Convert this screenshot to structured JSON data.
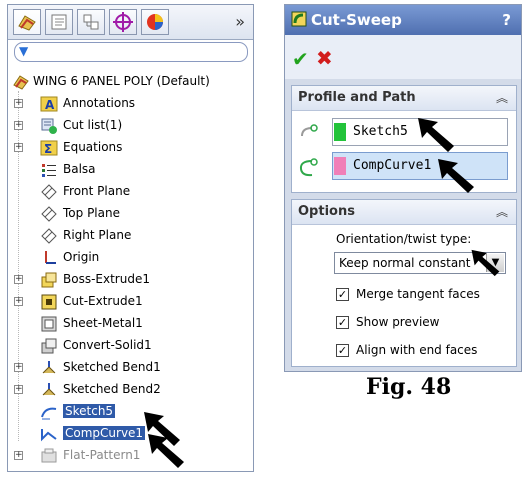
{
  "tree": {
    "root_label": "WING 6 PANEL POLY  (Default)",
    "items": [
      {
        "label": "Annotations",
        "expandable": true
      },
      {
        "label": "Cut list(1)",
        "expandable": true
      },
      {
        "label": "Equations",
        "expandable": true
      },
      {
        "label": "Balsa",
        "expandable": false
      },
      {
        "label": "Front Plane",
        "expandable": false
      },
      {
        "label": "Top Plane",
        "expandable": false
      },
      {
        "label": "Right Plane",
        "expandable": false
      },
      {
        "label": "Origin",
        "expandable": false
      },
      {
        "label": "Boss-Extrude1",
        "expandable": true
      },
      {
        "label": "Cut-Extrude1",
        "expandable": true
      },
      {
        "label": "Sheet-Metal1",
        "expandable": false
      },
      {
        "label": "Convert-Solid1",
        "expandable": false
      },
      {
        "label": "Sketched Bend1",
        "expandable": true
      },
      {
        "label": "Sketched Bend2",
        "expandable": true
      },
      {
        "label": "Sketch5",
        "expandable": false,
        "selected": true
      },
      {
        "label": "CompCurve1",
        "expandable": false,
        "selected": true
      },
      {
        "label": "Flat-Pattern1",
        "expandable": true,
        "dimmed": true
      }
    ],
    "more_tabs": "»"
  },
  "property_manager": {
    "title": "Cut-Sweep",
    "help": "?",
    "ok_symbol": "✔",
    "cancel_symbol": "✖",
    "profile_path": {
      "heading": "Profile and Path",
      "profile": "Sketch5",
      "path": "CompCurve1",
      "profile_color": "#22c33a",
      "path_color": "#f07fb8"
    },
    "options": {
      "heading": "Options",
      "orientation_label": "Orientation/twist type:",
      "orientation_value": "Keep normal constant",
      "checkboxes": [
        {
          "label": "Merge tangent faces",
          "checked": true
        },
        {
          "label": "Show preview",
          "checked": true
        },
        {
          "label": "Align with end faces",
          "checked": true
        }
      ]
    }
  },
  "caption": "Fig. 48"
}
